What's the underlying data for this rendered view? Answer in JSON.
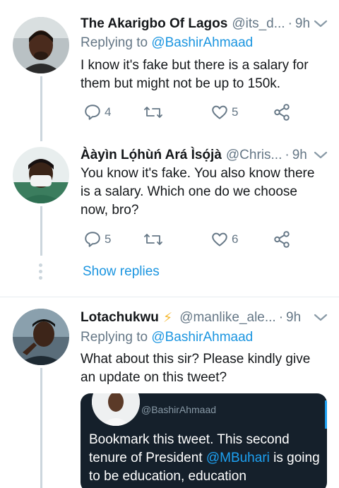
{
  "colors": {
    "accent": "#1b95e0",
    "muted": "#657786",
    "line": "#ccd6dd",
    "quote_bg": "#15202b"
  },
  "tweets": [
    {
      "name": "The Akarigbo Of Lagos",
      "handle": "@its_d...",
      "sep": "·",
      "time": "9h",
      "replying_prefix": "Replying to",
      "replying_to": "@BashirAhmaad",
      "text": "I know it's fake but there is a salary for them but might not be up to 150k.",
      "reply_count": "4",
      "like_count": "5"
    },
    {
      "name": "Ààyìn Lọ́hùń Ará Ìsọ́jà",
      "handle": "@Chris...",
      "sep": "·",
      "time": "9h",
      "text": "You know it's fake. You also know there is a salary. Which one do we choose now, bro?",
      "reply_count": "5",
      "like_count": "6"
    },
    {
      "name": "Lotachukwu",
      "emoji": "⚡",
      "handle": "@manlike_ale...",
      "sep": "·",
      "time": "9h",
      "replying_prefix": "Replying to",
      "replying_to": "@BashirAhmaad",
      "text": "What about this sir? Please kindly give an update on this tweet?"
    }
  ],
  "show_replies": "Show replies",
  "quoted": {
    "handle": "@BashirAhmaad",
    "text_before": "Bookmark this tweet. This second tenure of President ",
    "mention": "@MBuhari",
    "text_after": " is going to be education, education"
  },
  "icons": {
    "reply": "reply-icon",
    "retweet": "retweet-icon",
    "like": "heart-icon",
    "share": "share-icon",
    "more": "chevron-down-icon"
  }
}
